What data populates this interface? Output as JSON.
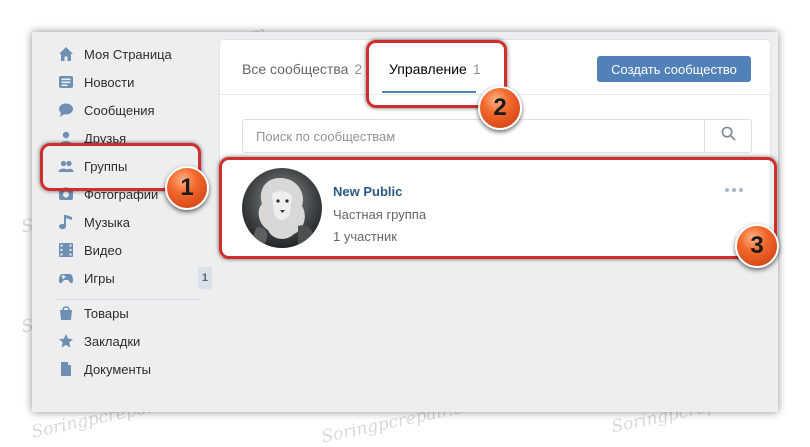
{
  "sidebar": {
    "items": [
      {
        "label": "Моя Страница",
        "icon": "home-icon"
      },
      {
        "label": "Новости",
        "icon": "news-icon"
      },
      {
        "label": "Сообщения",
        "icon": "messages-icon"
      },
      {
        "label": "Друзья",
        "icon": "friends-icon"
      },
      {
        "label": "Группы",
        "icon": "groups-icon"
      },
      {
        "label": "Фотографии",
        "icon": "photos-icon"
      },
      {
        "label": "Музыка",
        "icon": "music-icon"
      },
      {
        "label": "Видео",
        "icon": "video-icon"
      },
      {
        "label": "Игры",
        "icon": "games-icon",
        "badge": "1"
      },
      {
        "label": "Товары",
        "icon": "goods-icon"
      },
      {
        "label": "Закладки",
        "icon": "bookmarks-icon"
      },
      {
        "label": "Документы",
        "icon": "documents-icon"
      }
    ]
  },
  "tabs": {
    "all": {
      "label": "Все сообщества",
      "count": "2"
    },
    "manage": {
      "label": "Управление",
      "count": "1"
    }
  },
  "create_button": "Создать сообщество",
  "search": {
    "placeholder": "Поиск по сообществам"
  },
  "group": {
    "name": "New Public",
    "type": "Частная группа",
    "members": "1 участник"
  },
  "markers": [
    "1",
    "2",
    "3"
  ],
  "watermark": "Soringpcrepair.com",
  "colors": {
    "accent": "#5181b8",
    "link": "#2a5885",
    "highlight": "#d22d2d",
    "marker": "#f26a2d"
  }
}
